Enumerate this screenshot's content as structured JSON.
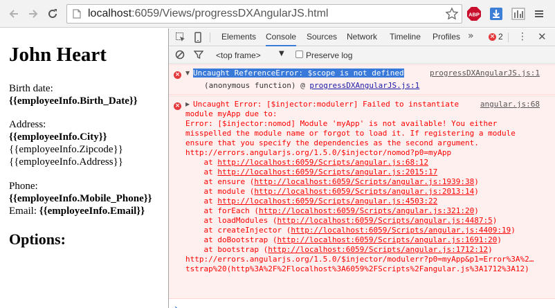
{
  "browser": {
    "url_host": "localhost",
    "url_rest": ":6059/Views/progressDXAngularJS.html",
    "colors": {
      "abp": "#c8102e",
      "download": "#3d7fd6"
    }
  },
  "page": {
    "name": "John Heart",
    "birth_label": "Birth date:",
    "birth_value": "{{employeeInfo.Birth_Date}}",
    "address_label": "Address:",
    "city": "{{employeeInfo.City}}",
    "zipcode": "{{employeeInfo.Zipcode}}",
    "address": "{{employeeInfo.Address}}",
    "phone_label": "Phone:",
    "phone_value": "{{employeeInfo.Mobile_Phone}}",
    "email_label": "Email:",
    "email_value": "{{employeeInfo.Email}}",
    "options_heading": "Options:"
  },
  "devtools": {
    "tabs": [
      "Elements",
      "Console",
      "Sources",
      "Network",
      "Timeline",
      "Profiles"
    ],
    "active_tab": "Console",
    "more": "»",
    "error_count": "2",
    "frame_select": "<top frame>",
    "preserve_log": "Preserve log",
    "messages": {
      "m1": {
        "text": "Uncaught ReferenceError: $scope is not defined",
        "source": "progressDXAngularJS.js:1",
        "sub_prefix": "(anonymous function) @ ",
        "sub_link": "progressDXAngularJS.js:1"
      },
      "m2": {
        "line1": "Uncaught Error: [$injector:modulerr] Failed to instantiate",
        "source": "angular.js:68",
        "line2": "module myApp due to:",
        "line3": "Error: [$injector:nomod] Module 'myApp' is not available! You either",
        "line4": "misspelled the module name or forgot to load it. If registering a module",
        "line5": "ensure that you specify the dependencies as the second argument.",
        "line6": "http://errors.angularjs.org/1.5.0/$injector/nomod?p0=myApp",
        "stack": [
          {
            "prefix": "    at ",
            "link": "http://localhost:6059/Scripts/angular.js:68:12",
            "open": "",
            "close": ""
          },
          {
            "prefix": "    at ",
            "link": "http://localhost:6059/Scripts/angular.js:2015:17",
            "open": "",
            "close": ""
          },
          {
            "prefix": "    at ensure ",
            "link": "http://localhost:6059/Scripts/angular.js:1939:38",
            "open": "(",
            "close": ")"
          },
          {
            "prefix": "    at module ",
            "link": "http://localhost:6059/Scripts/angular.js:2013:14",
            "open": "(",
            "close": ")"
          },
          {
            "prefix": "    at ",
            "link": "http://localhost:6059/Scripts/angular.js:4503:22",
            "open": "",
            "close": ""
          },
          {
            "prefix": "    at forEach ",
            "link": "http://localhost:6059/Scripts/angular.js:321:20",
            "open": "(",
            "close": ")"
          },
          {
            "prefix": "    at loadModules ",
            "link": "http://localhost:6059/Scripts/angular.js:4487:5",
            "open": "(",
            "close": ")"
          },
          {
            "prefix": "    at createInjector ",
            "link": "http://localhost:6059/Scripts/angular.js:4409:19",
            "open": "(",
            "close": ")"
          },
          {
            "prefix": "    at doBootstrap ",
            "link": "http://localhost:6059/Scripts/angular.js:1691:20",
            "open": "(",
            "close": ")"
          },
          {
            "prefix": "    at bootstrap ",
            "link": "http://localhost:6059/Scripts/angular.js:1712:12",
            "open": "(",
            "close": ")"
          }
        ],
        "line_tail1": "http://errors.angularjs.org/1.5.0/$injector/modulerr?p0=myApp&p1=Error%3A%2…",
        "line_tail2": "tstrap%20(http%3A%2F%2Flocalhost%3A6059%2FScripts%2Fangular.js%3A1712%3A12)"
      }
    },
    "prompt": "›"
  }
}
